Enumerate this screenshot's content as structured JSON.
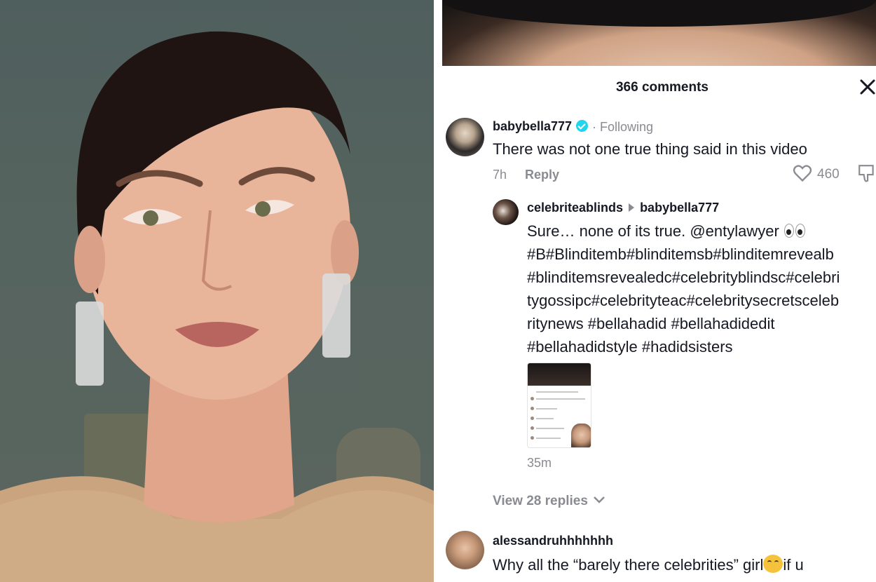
{
  "header": {
    "comments_count": "366 comments",
    "close_icon": "close-icon"
  },
  "comment1": {
    "username": "babybella777",
    "verified": true,
    "following": "· Following",
    "text": "There was not one true thing said in this video",
    "time": "7h",
    "reply_label": "Reply",
    "likes": "460"
  },
  "reply1": {
    "username": "celebriteablinds",
    "reply_to": "babybella777",
    "text_line1": "Sure… none of its true. @entylawyer",
    "text_rest": "#B#Blinditemb#blinditemsb#blinditemrevealb #blinditemsrevealedc#celebrityblindsc#celebrity gossipc#celebrityteac#celebritysecretsceleb ritynews #bellahadid #bellahadidedit #bellahadidstyle #hadidsisters",
    "lines": [
      "#B#Blinditemb#blinditemsb#blinditemrevealb",
      "#blinditemsrevealedc#celebrityblindsc#celebri",
      "tygossipc#celebrityteac#celebritysecretsceleb",
      "ritynews #bellahadid #bellahadidedit",
      "#bellahadidstyle #hadidsisters"
    ],
    "time": "35m"
  },
  "view_replies": "View 28 replies",
  "comment2": {
    "username": "alessandruhhhhhhh",
    "text": "Why all the “barely there celebrities” girl",
    "text_after": "if u"
  },
  "colors": {
    "text": "#161823",
    "muted": "#8a8b91",
    "verified": "#20d5ec"
  }
}
